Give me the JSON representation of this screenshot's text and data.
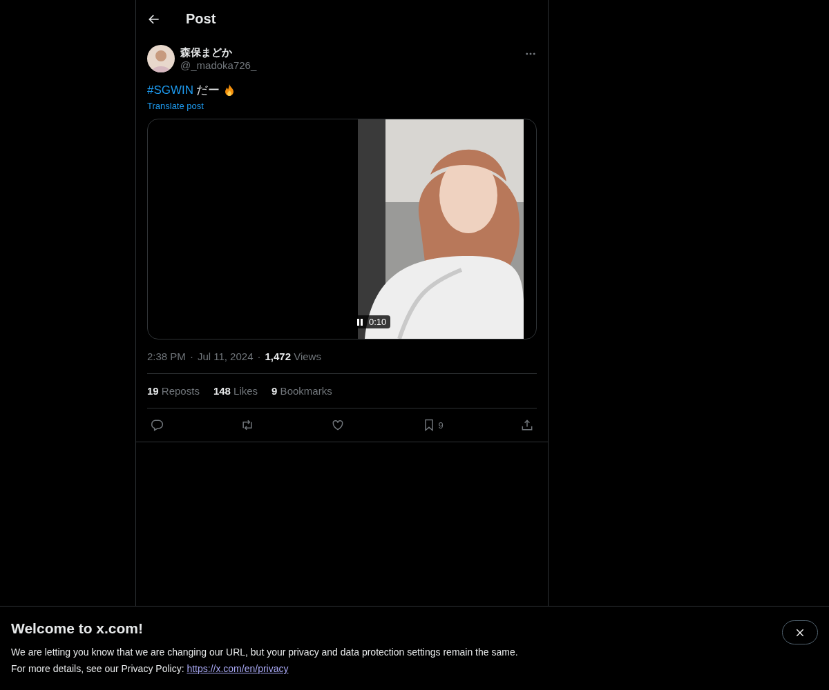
{
  "header": {
    "title": "Post"
  },
  "post": {
    "display_name": "森保まどか",
    "handle": "@_madoka726_",
    "hashtag": "#SGWIN",
    "text": "だー",
    "translate": "Translate post",
    "video": {
      "time": "0:10",
      "playing": true
    },
    "meta": {
      "time": "2:38 PM",
      "separators": [
        "·",
        "·"
      ],
      "date": "Jul 11, 2024",
      "views": "**1,472** Views"
    },
    "stats": [
      "**19** Reposts",
      "**148** Likes",
      "**9** Bookmarks"
    ],
    "actions": [
      {
        "kind": "reply"
      },
      {
        "kind": "repost"
      },
      {
        "kind": "like"
      },
      {
        "kind": "bookmark",
        "count": "9"
      },
      {
        "kind": "share"
      }
    ]
  },
  "banner": {
    "title": "Welcome to x.com!",
    "line1": "We are letting you know that we are changing our URL, but your privacy and data protection settings remain the same.",
    "line2": "For more details, see our Privacy Policy:",
    "link": "https://x.com/en/privacy"
  }
}
